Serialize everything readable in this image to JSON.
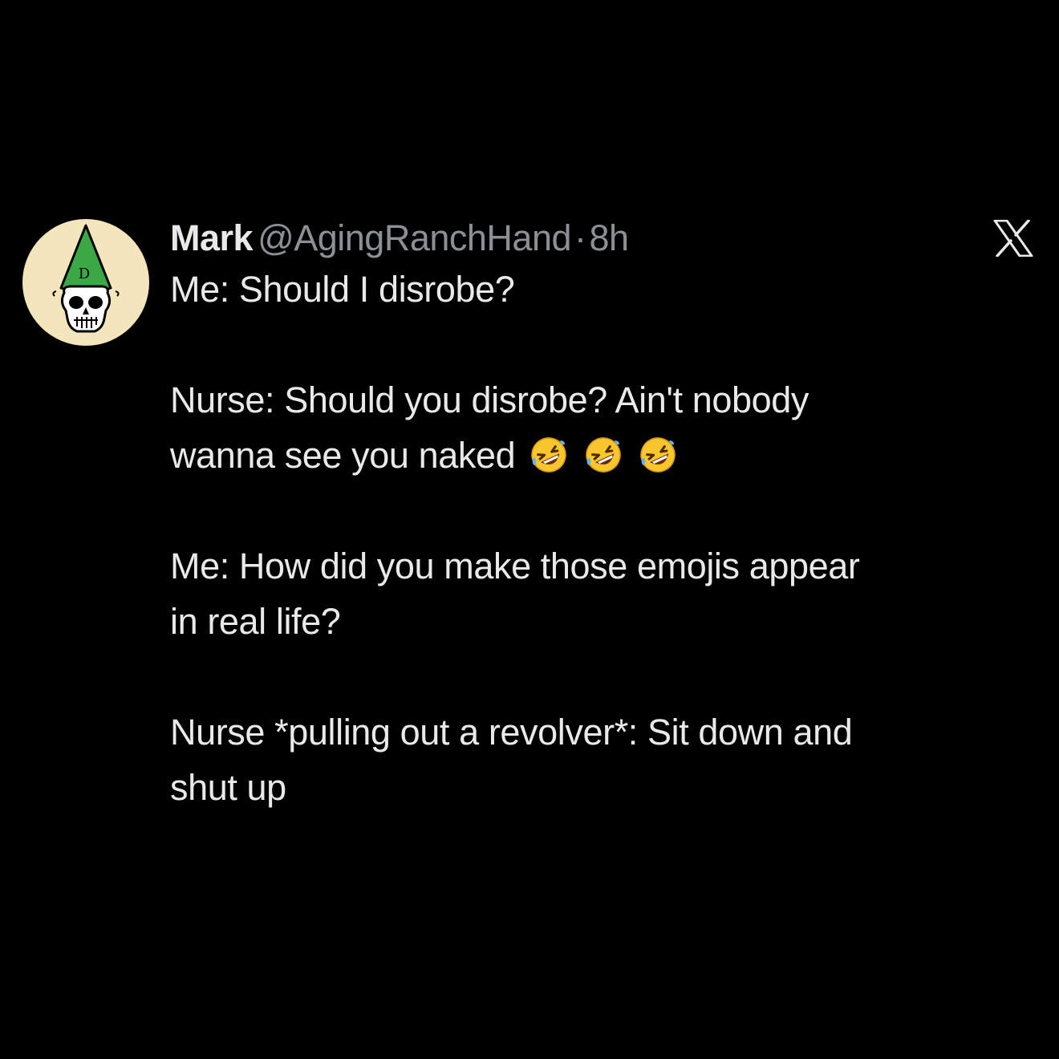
{
  "tweet": {
    "author_name": "Mark",
    "author_handle": "@AgingRanchHand",
    "separator": "·",
    "timestamp": "8h",
    "avatar_icon": "skull-with-green-dunce-cap",
    "avatar_hat_letter": "D",
    "platform_logo": "x-logo",
    "paragraphs": [
      {
        "lines": [
          "Me: Should I disrobe?"
        ]
      },
      {
        "lines": [
          "Nurse: Should you disrobe? Ain't nobody",
          "wanna see you naked"
        ],
        "emoji_count": 3,
        "emoji": "rolling-on-floor-laughing"
      },
      {
        "lines": [
          "Me: How did you make those emojis appear",
          "in real life?"
        ]
      },
      {
        "lines": [
          "Nurse *pulling out a revolver*: Sit down and",
          "shut up"
        ]
      }
    ]
  },
  "colors": {
    "background": "#000000",
    "text_primary": "#e7e9ea",
    "text_secondary": "#8b9095",
    "avatar_bg": "#f3e6bd",
    "hat_green": "#3aa845"
  }
}
